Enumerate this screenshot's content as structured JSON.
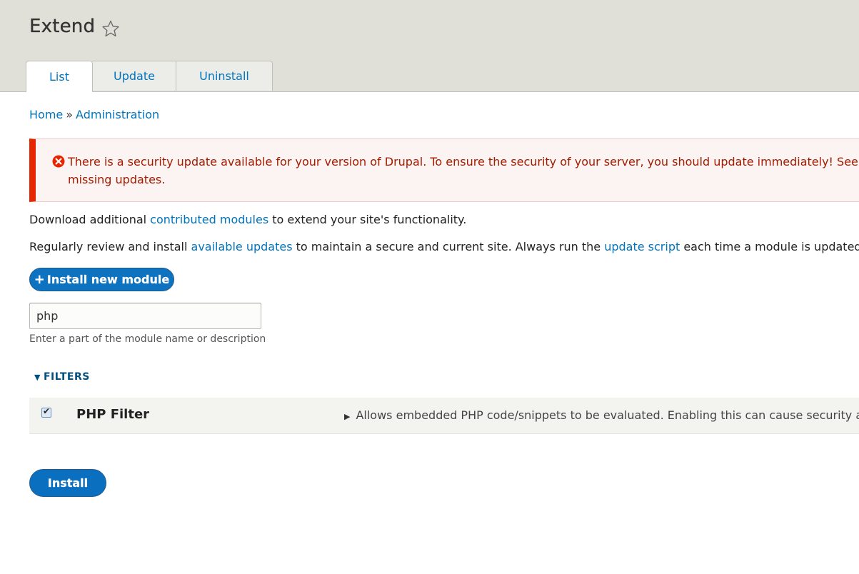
{
  "page": {
    "title": "Extend"
  },
  "tabs": [
    {
      "label": "List",
      "active": true
    },
    {
      "label": "Update",
      "active": false
    },
    {
      "label": "Uninstall",
      "active": false
    }
  ],
  "breadcrumb": {
    "home": "Home",
    "separator": "»",
    "admin": "Administration"
  },
  "message": {
    "type": "error",
    "line1": "There is a security update available for your version of Drupal. To ensure the security of your server, you should update immediately! See the",
    "line2": "missing updates."
  },
  "intro": {
    "p1_before": "Download additional ",
    "p1_link": "contributed modules",
    "p1_after": " to extend your site's functionality.",
    "p2_before": "Regularly review and install ",
    "p2_link1": "available updates",
    "p2_middle": " to maintain a secure and current site. Always run the ",
    "p2_link2": "update script",
    "p2_after": " each time a module is updated."
  },
  "buttons": {
    "install_new_plus": "+",
    "install_new": "Install new module",
    "install": "Install"
  },
  "filter": {
    "value": "php",
    "description": "Enter a part of the module name or description"
  },
  "filters_toggle": {
    "icon": "▼",
    "label": "FILTERS"
  },
  "modules": [
    {
      "checked": true,
      "name": "PHP Filter",
      "description": "Allows embedded PHP code/snippets to be evaluated. Enabling this can cause security ar"
    }
  ],
  "colors": {
    "accent": "#0074bd",
    "error": "#e62600",
    "header_bg": "#e0e0d8"
  }
}
